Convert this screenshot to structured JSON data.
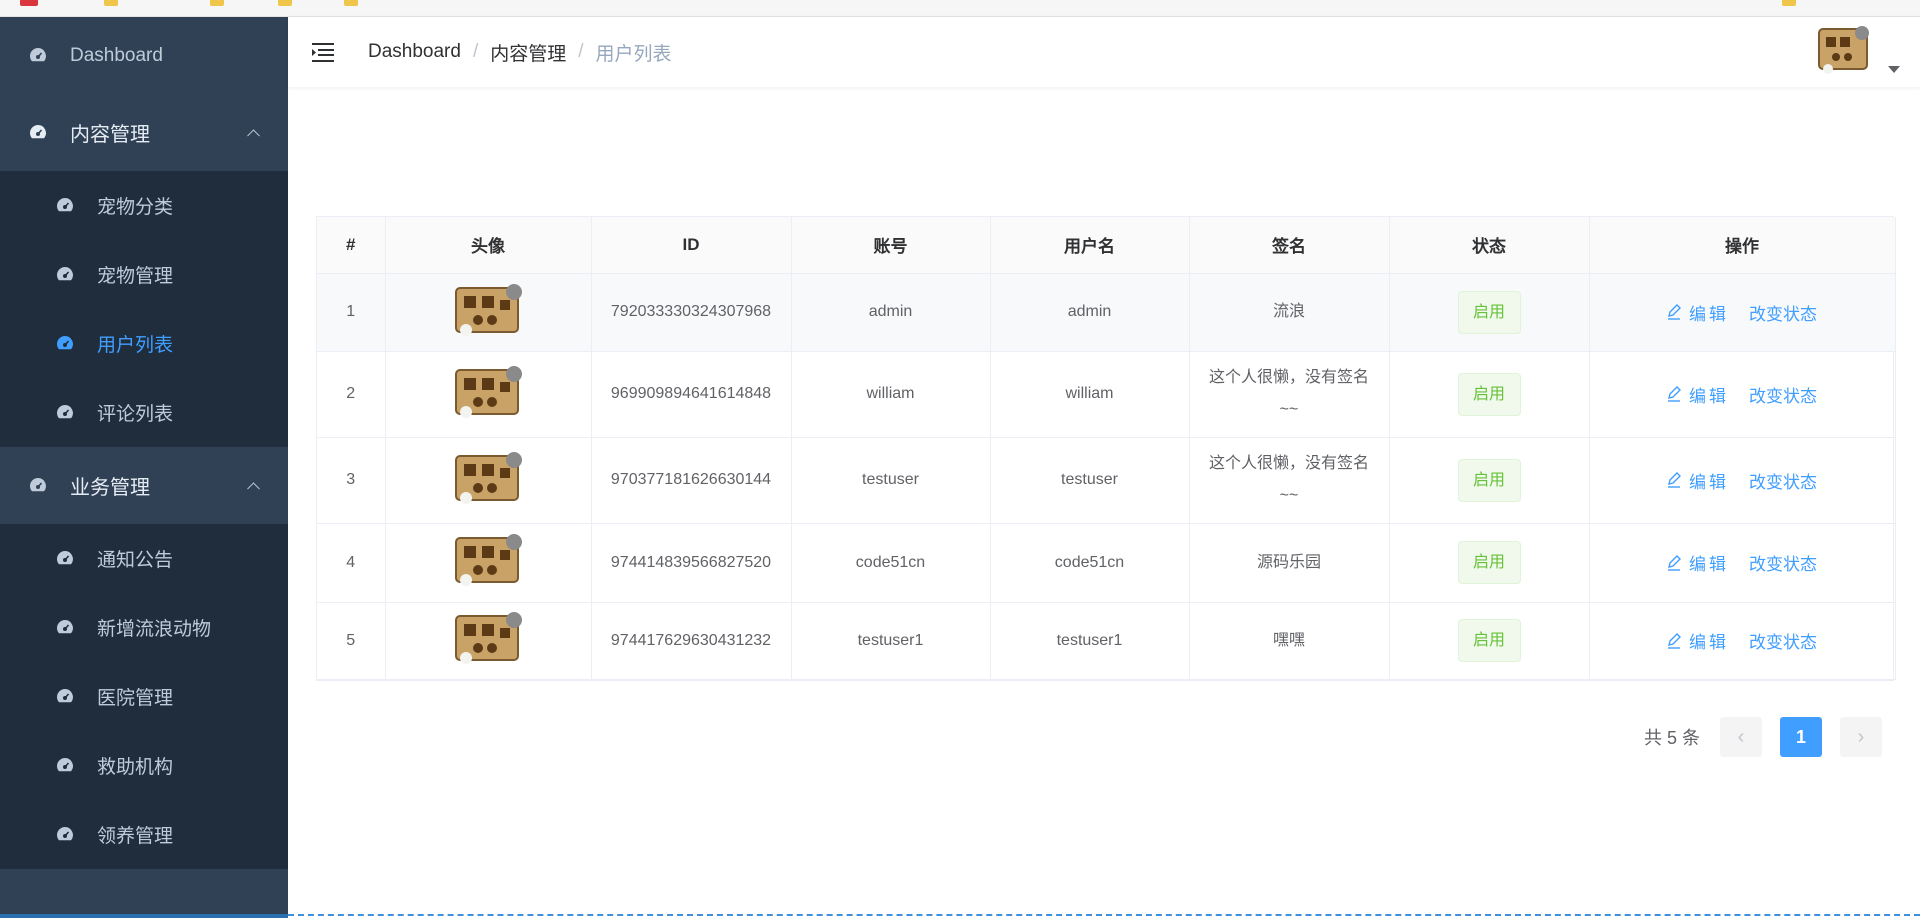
{
  "sidebar": {
    "dashboard": "Dashboard",
    "groups": [
      {
        "title": "内容管理",
        "items": [
          "宠物分类",
          "宠物管理",
          "用户列表",
          "评论列表"
        ]
      },
      {
        "title": "业务管理",
        "items": [
          "通知公告",
          "新增流浪动物",
          "医院管理",
          "救助机构",
          "领养管理"
        ]
      }
    ],
    "active_item": "用户列表"
  },
  "navbar": {
    "breadcrumb": [
      "Dashboard",
      "内容管理",
      "用户列表"
    ],
    "separator": "/"
  },
  "table": {
    "headers": [
      "#",
      "头像",
      "ID",
      "账号",
      "用户名",
      "签名",
      "状态",
      "操作"
    ],
    "rows": [
      {
        "index": "1",
        "id": "792033330324307968",
        "account": "admin",
        "username": "admin",
        "signature": "流浪",
        "status": "启用"
      },
      {
        "index": "2",
        "id": "969909894641614848",
        "account": "william",
        "username": "william",
        "signature": "这个人很懒，没有签名~~",
        "status": "启用"
      },
      {
        "index": "3",
        "id": "970377181626630144",
        "account": "testuser",
        "username": "testuser",
        "signature": "这个人很懒，没有签名~~",
        "status": "启用"
      },
      {
        "index": "4",
        "id": "974414839566827520",
        "account": "code51cn",
        "username": "code51cn",
        "signature": "源码乐园",
        "status": "启用"
      },
      {
        "index": "5",
        "id": "974417629630431232",
        "account": "testuser1",
        "username": "testuser1",
        "signature": "嘿嘿",
        "status": "启用"
      }
    ],
    "actions": {
      "edit": "编辑",
      "toggle": "改变状态"
    }
  },
  "pagination": {
    "total_text": "共 5 条",
    "current_page": "1",
    "prev": "‹",
    "next": "›"
  },
  "colors": {
    "sidebar_bg": "#304156",
    "submenu_bg": "#1f2d3d",
    "accent": "#409eff",
    "success": "#67c23a"
  }
}
